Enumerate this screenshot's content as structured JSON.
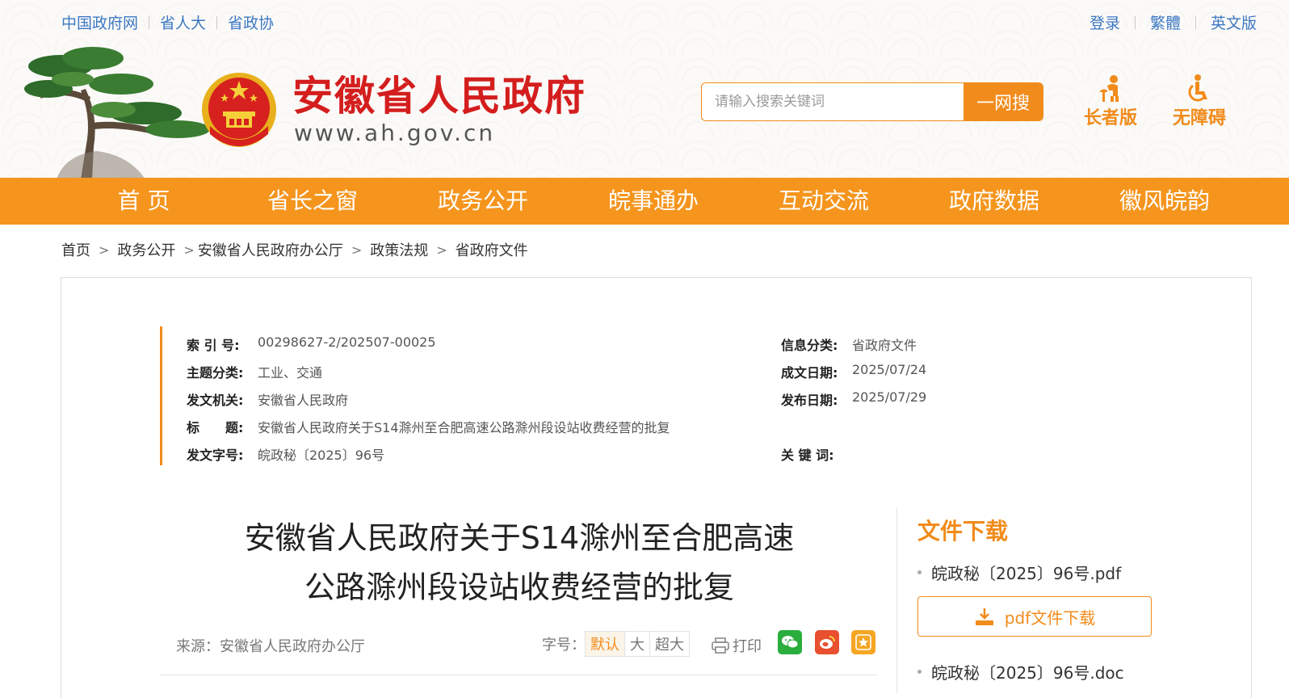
{
  "topbar": {
    "left": [
      "中国政府网",
      "省人大",
      "省政协"
    ],
    "right": [
      "登录",
      "繁體",
      "英文版"
    ]
  },
  "site": {
    "title": "安徽省人民政府",
    "url": "www.ah.gov.cn"
  },
  "search": {
    "placeholder": "请输入搜索关键词",
    "button": "一网搜"
  },
  "services": {
    "elder": "长者版",
    "accessible": "无障碍"
  },
  "nav": [
    "首 页",
    "省长之窗",
    "政务公开",
    "皖事通办",
    "互动交流",
    "政府数据",
    "徽风皖韵"
  ],
  "breadcrumb": [
    "首页",
    "政务公开",
    "安徽省人民政府办公厅",
    "政策法规",
    "省政府文件"
  ],
  "meta": {
    "index_label": "索 引 号:",
    "index_value": "00298627-2/202507-00025",
    "topic_label": "主题分类:",
    "topic_value": "工业、交通",
    "issuer_label": "发文机关:",
    "issuer_value": "安徽省人民政府",
    "title_label": "标　　题:",
    "title_value": "安徽省人民政府关于S14滁州至合肥高速公路滁州段设站收费经营的批复",
    "docno_label": "发文字号:",
    "docno_value": "皖政秘〔2025〕96号",
    "category_label": "信息分类:",
    "category_value": "省政府文件",
    "written_label": "成文日期:",
    "written_value": "2025/07/24",
    "published_label": "发布日期:",
    "published_value": "2025/07/29",
    "keywords_label": "关 键 词:",
    "keywords_value": ""
  },
  "article": {
    "title_line1": "安徽省人民政府关于S14滁州至合肥高速",
    "title_line2": "公路滁州段设站收费经营的批复",
    "source": "来源：安徽省人民政府办公厅",
    "fontsize_label": "字号：",
    "fontsize_options": [
      "默认",
      "大",
      "超大"
    ],
    "print": "打印"
  },
  "downloads": {
    "title": "文件下载",
    "file1": "皖政秘〔2025〕96号.pdf",
    "button": "pdf文件下载",
    "file2": "皖政秘〔2025〕96号.doc"
  },
  "colors": {
    "brand_orange": "#f5951d",
    "title_red": "#d41e1e",
    "link_blue": "#3d78c3"
  }
}
